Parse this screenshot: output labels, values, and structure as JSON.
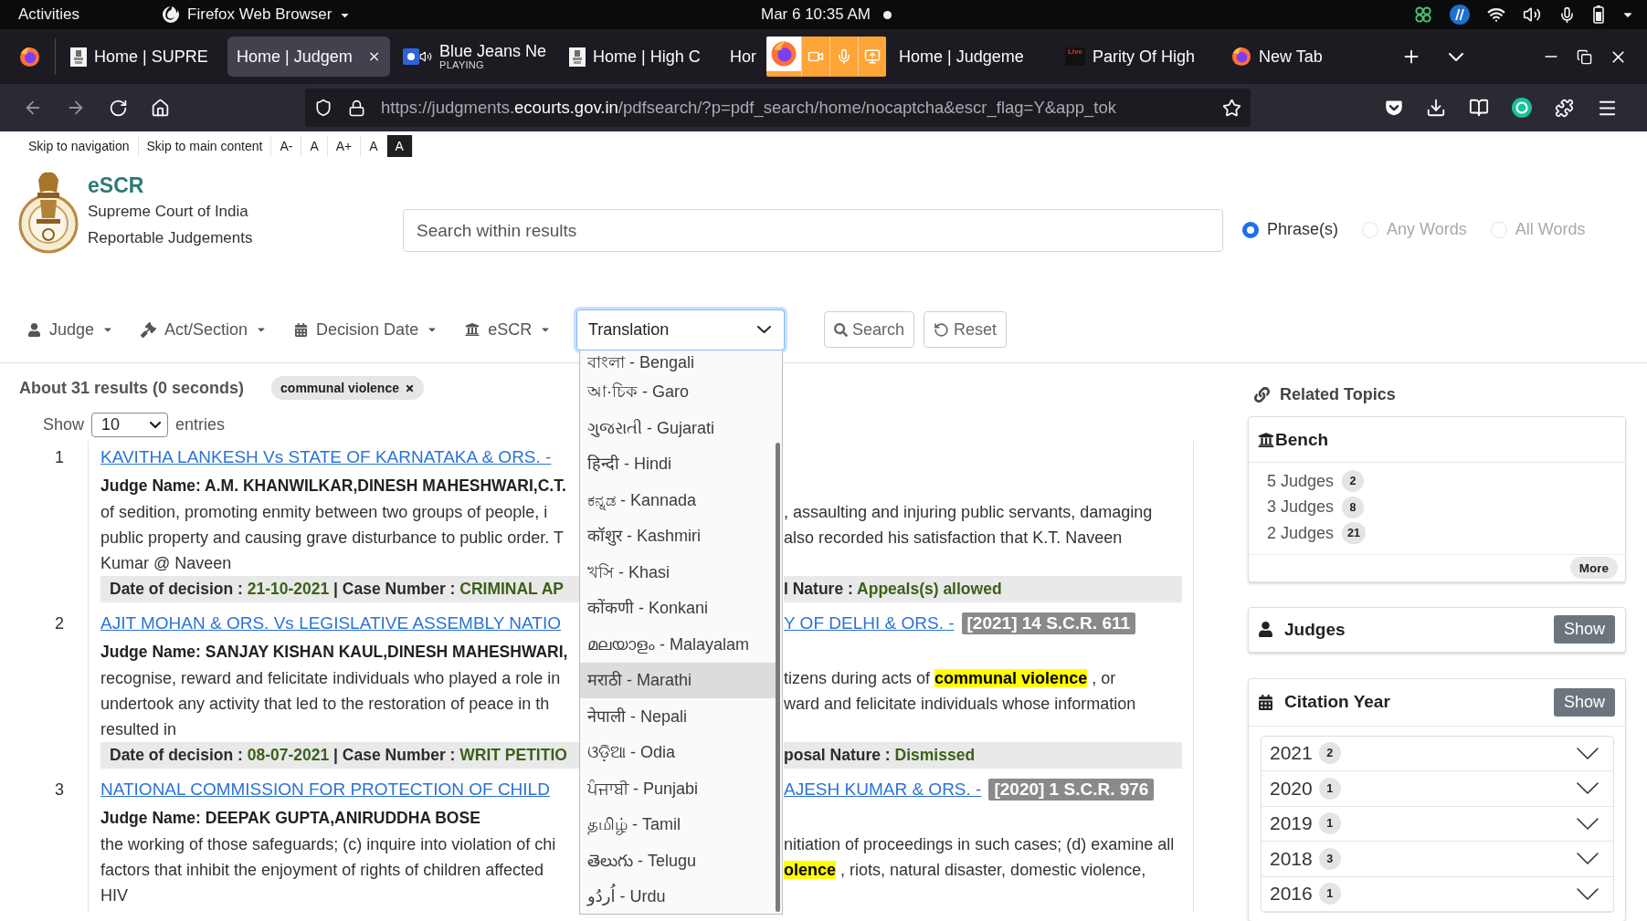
{
  "top_bar": {
    "activities": "Activities",
    "app_menu": "Firefox Web Browser",
    "clock": "Mar 6 10:35 AM"
  },
  "tabs": [
    {
      "title": "Home | SUPRE",
      "kind": "page",
      "selected": false
    },
    {
      "title": "Home | Judgem",
      "kind": "text",
      "selected": true
    },
    {
      "title": "Blue Jeans Ne",
      "subtitle": "PLAYING",
      "kind": "media",
      "selected": false
    },
    {
      "title": "Home | High C",
      "kind": "page",
      "selected": false
    },
    {
      "title": "Hor",
      "kind": "covered",
      "selected": false
    },
    {
      "title": "Home | Judgeme",
      "kind": "text",
      "selected": false
    },
    {
      "title": "Parity Of High",
      "kind": "live",
      "badge": "Live",
      "selected": false
    },
    {
      "title": "New Tab",
      "kind": "browser",
      "selected": false
    }
  ],
  "url": {
    "start": "https://judgments.",
    "domain": "ecourts.gov.in",
    "path": "/pdfsearch/?p=pdf_search/home/nocaptcha&escr_flag=Y&app_tok"
  },
  "skip_links": [
    {
      "label": "Skip to navigation",
      "kind": "light"
    },
    {
      "label": "Skip to main content",
      "kind": "light"
    },
    {
      "label": "A-",
      "kind": "light"
    },
    {
      "label": "A",
      "kind": "light"
    },
    {
      "label": "A+",
      "kind": "light"
    },
    {
      "label": "A",
      "kind": "light"
    },
    {
      "label": "A",
      "kind": "dark"
    }
  ],
  "site": {
    "name": "eSCR",
    "subtitle_lines": [
      "Supreme Court of India",
      "Reportable Judgements"
    ]
  },
  "search": {
    "placeholder": "Search within results"
  },
  "match_modes": [
    {
      "label": "Phrase(s)",
      "selected": true
    },
    {
      "label": "Any Words",
      "selected": false
    },
    {
      "label": "All Words",
      "selected": false
    }
  ],
  "filters": [
    {
      "label": "Judge"
    },
    {
      "label": "Act/Section"
    },
    {
      "label": "Decision Date"
    },
    {
      "label": "eSCR"
    }
  ],
  "translation": {
    "value": "Translation",
    "expanded": true,
    "options": [
      {
        "label": "বাংলা - Bengali",
        "selected": false
      },
      {
        "label": "আ·চিক - Garo",
        "selected": false
      },
      {
        "label": "ગુજરાતી - Gujarati",
        "selected": false
      },
      {
        "label": "हिन्दी - Hindi",
        "selected": false
      },
      {
        "label": "ಕನ್ನಡ - Kannada",
        "selected": false
      },
      {
        "label": "कॉशुर - Kashmiri",
        "selected": false
      },
      {
        "label": "খসি - Khasi",
        "selected": false
      },
      {
        "label": "कोंकणी - Konkani",
        "selected": false
      },
      {
        "label": "മലയാളം - Malayalam",
        "selected": false
      },
      {
        "label": "मराठी - Marathi",
        "selected": true
      },
      {
        "label": "नेपाली - Nepali",
        "selected": false
      },
      {
        "label": "ଓଡ଼ିଆ - Odia",
        "selected": false
      },
      {
        "label": "ਪੰਜਾਬੀ - Punjabi",
        "selected": false
      },
      {
        "label": "தமிழ் - Tamil",
        "selected": false
      },
      {
        "label": "తెలుగు - Telugu",
        "selected": false
      },
      {
        "label": "اُردُو - Urdu",
        "selected": false
      }
    ]
  },
  "actions": [
    {
      "label": "Search"
    },
    {
      "label": "Reset"
    }
  ],
  "summary": "About 31 results (0 seconds)",
  "query_tags": [
    {
      "label": "communal violence"
    }
  ],
  "page_size": {
    "before": "Show",
    "value": "10",
    "after": "entries"
  },
  "results": [
    {
      "number": "1",
      "title": {
        "left": "KAVITHA LANKESH Vs STATE OF KARNATAKA & ORS. -"
      },
      "judge": "Judge Name: A.M. KHANWILKAR,DINESH MAHESHWARI,C.T.",
      "snippet": [
        {
          "left": [
            {
              "text": "of sedition, promoting enmity between two groups of people, i",
              "kind": "plain"
            }
          ],
          "right": [
            {
              "text": ", assaulting and injuring public servants, damaging",
              "kind": "plain"
            }
          ]
        },
        {
          "left": [
            {
              "text": "public property and causing grave disturbance to public order. T",
              "kind": "plain"
            }
          ],
          "right": [
            {
              "text": "also recorded his satisfaction that K.T. Naveen",
              "kind": "plain"
            }
          ]
        },
        {
          "left": [
            {
              "text": "Kumar @ Naveen",
              "kind": "plain"
            }
          ]
        }
      ],
      "decision": {
        "left": [
          {
            "text": "Date of decision : ",
            "kind": "label"
          },
          {
            "text": "21-10-2021",
            "kind": "value"
          },
          {
            "text": " | Case Number : ",
            "kind": "label"
          },
          {
            "text": "CRIMINAL AP",
            "kind": "value"
          }
        ],
        "right": [
          {
            "text": "l Nature : ",
            "kind": "label"
          },
          {
            "text": "Appeals(s) allowed",
            "kind": "value"
          }
        ]
      }
    },
    {
      "number": "2",
      "title": {
        "left": "AJIT MOHAN & ORS. Vs LEGISLATIVE ASSEMBLY NATIO",
        "right": "Y OF DELHI & ORS. -",
        "citation": "[2021] 14 S.C.R. 611"
      },
      "judge": "Judge Name: SANJAY KISHAN KAUL,DINESH MAHESHWARI,",
      "snippet": [
        {
          "left": [
            {
              "text": "recognise, reward and felicitate individuals who played a role in",
              "kind": "plain"
            }
          ],
          "right": [
            {
              "text": "tizens during acts of ",
              "kind": "plain"
            },
            {
              "text": "communal violence",
              "kind": "highlight"
            },
            {
              "text": " , or",
              "kind": "plain"
            }
          ]
        },
        {
          "left": [
            {
              "text": "undertook any activity that led to the restoration of peace in th",
              "kind": "plain"
            }
          ],
          "right": [
            {
              "text": "ward and felicitate individuals whose information",
              "kind": "plain"
            }
          ]
        },
        {
          "left": [
            {
              "text": "resulted in",
              "kind": "plain"
            }
          ]
        }
      ],
      "decision": {
        "left": [
          {
            "text": "Date of decision : ",
            "kind": "label"
          },
          {
            "text": "08-07-2021",
            "kind": "value"
          },
          {
            "text": " | Case Number : ",
            "kind": "label"
          },
          {
            "text": "WRIT PETITIO",
            "kind": "value"
          }
        ],
        "right": [
          {
            "text": "posal Nature : ",
            "kind": "label"
          },
          {
            "text": "Dismissed",
            "kind": "value"
          }
        ]
      }
    },
    {
      "number": "3",
      "title": {
        "left": "NATIONAL COMMISSION FOR PROTECTION OF CHILD",
        "right": "AJESH KUMAR & ORS. -",
        "citation": "[2020] 1 S.C.R. 976"
      },
      "judge": "Judge Name: DEEPAK GUPTA,ANIRUDDHA BOSE",
      "snippet": [
        {
          "left": [
            {
              "text": "the working of those safeguards; (c) inquire into violation of chi",
              "kind": "plain"
            }
          ],
          "right": [
            {
              "text": "nitiation of proceedings in such cases; (d) examine all",
              "kind": "plain"
            }
          ]
        },
        {
          "left": [
            {
              "text": "factors that inhibit the enjoyment of rights of children affected",
              "kind": "plain"
            }
          ],
          "right": [
            {
              "text": "olence",
              "kind": "highlight"
            },
            {
              "text": " , riots, natural disaster, domestic violence,",
              "kind": "plain"
            }
          ]
        },
        {
          "left": [
            {
              "text": "HIV",
              "kind": "plain"
            }
          ]
        }
      ]
    }
  ],
  "related": {
    "title": "Related Topics",
    "bench": {
      "title": "Bench",
      "items": [
        {
          "label": "5 Judges",
          "count": "2"
        },
        {
          "label": "3 Judges",
          "count": "8"
        },
        {
          "label": "2 Judges",
          "count": "21"
        }
      ],
      "more": "More"
    },
    "judges": {
      "title": "Judges",
      "action": "Show"
    },
    "citation_year": {
      "title": "Citation Year",
      "action": "Show",
      "years": [
        {
          "label": "2021",
          "count": "2",
          "expanded": false
        },
        {
          "label": "2020",
          "count": "1",
          "expanded": false
        },
        {
          "label": "2019",
          "count": "1",
          "expanded": false
        },
        {
          "label": "2018",
          "count": "3",
          "expanded": false
        },
        {
          "label": "2016",
          "count": "1",
          "expanded": false
        }
      ]
    }
  }
}
